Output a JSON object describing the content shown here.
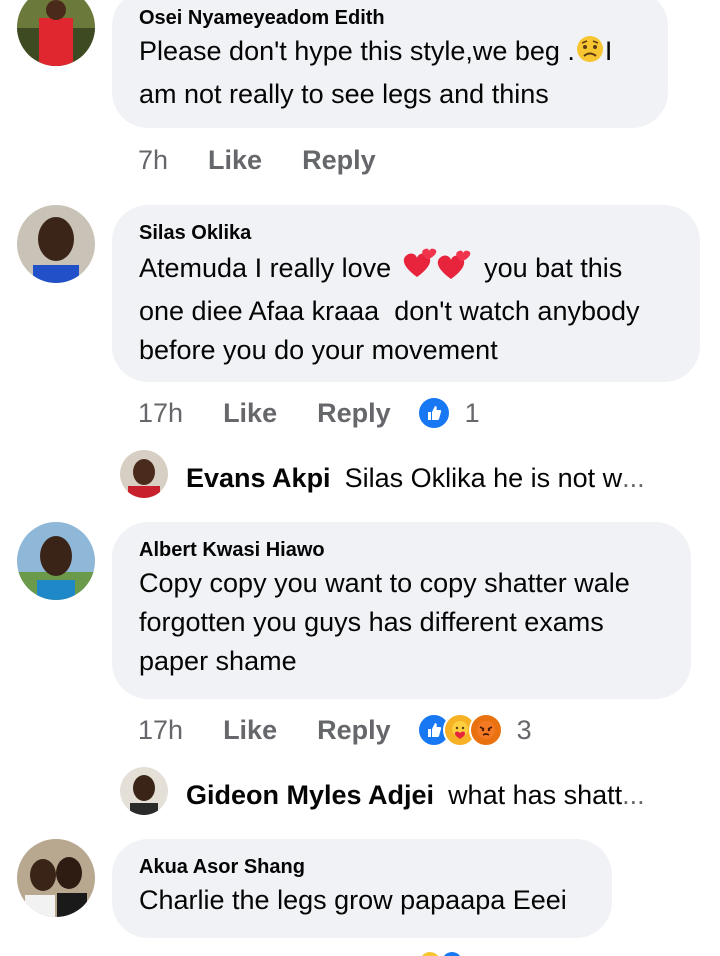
{
  "comments": [
    {
      "author": "Osei Nyameyeadom Edith",
      "text_before": "Please don't hype this style,we beg .",
      "text_after": "I am not really to see legs and thins",
      "emoji": "sad-face",
      "time": "7h",
      "like_label": "Like",
      "reply_label": "Reply"
    },
    {
      "author": "Silas Oklika",
      "text_before": "Atemuda I really love ",
      "text_after": " you bat this one diee Afaa kraaa  don't watch anybody before you do your movement",
      "emoji": "two-hearts",
      "time": "17h",
      "like_label": "Like",
      "reply_label": "Reply",
      "reaction_count": "1",
      "reply": {
        "name": "Evans Akpi",
        "text": "Silas Oklika he is not w",
        "ellipsis": "..."
      }
    },
    {
      "author": "Albert Kwasi Hiawo",
      "text": "Copy copy you want to copy shatter wale forgotten you guys has different exams paper shame",
      "time": "17h",
      "like_label": "Like",
      "reply_label": "Reply",
      "reaction_count": "3",
      "reply": {
        "name": "Gideon Myles Adjei",
        "text": "what has shatt",
        "ellipsis": "..."
      }
    },
    {
      "author": "Akua Asor Shang",
      "text": "Charlie the legs grow papaapa Eeei"
    }
  ],
  "colors": {
    "bubble": "#f0f2f5",
    "meta_text": "#65676b",
    "like_blue": "#1877f2"
  }
}
